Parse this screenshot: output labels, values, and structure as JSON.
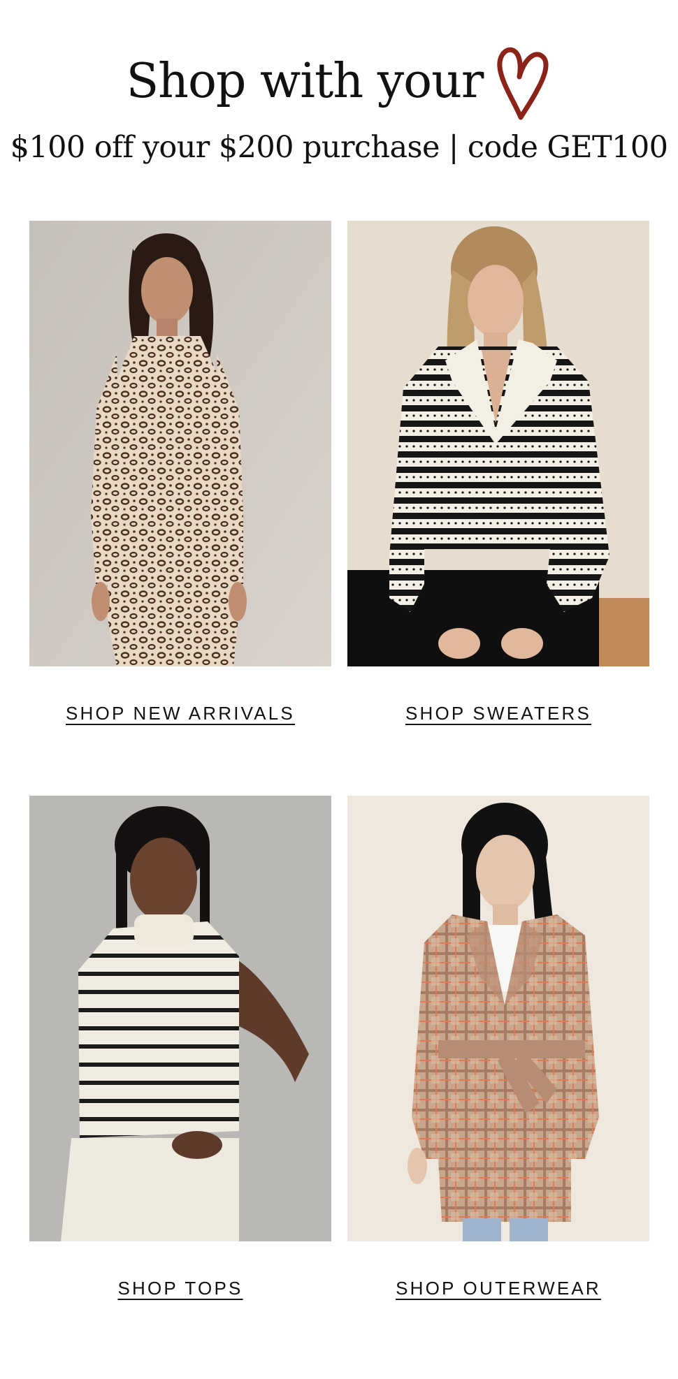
{
  "header": {
    "headline": "Shop with your",
    "heart_icon": "heart-icon",
    "heart_color": "#8b2319",
    "promo": "$100 off your $200 purchase | code GET100"
  },
  "tiles": [
    {
      "cta": "SHOP NEW ARRIVALS",
      "photo": "model-in-leopard-print-dress"
    },
    {
      "cta": "SHOP SWEATERS",
      "photo": "model-in-striped-collared-sweater"
    },
    {
      "cta": "SHOP TOPS",
      "photo": "model-in-striped-sleeveless-knit-top"
    },
    {
      "cta": "SHOP OUTERWEAR",
      "photo": "model-in-plaid-belted-coat"
    }
  ]
}
